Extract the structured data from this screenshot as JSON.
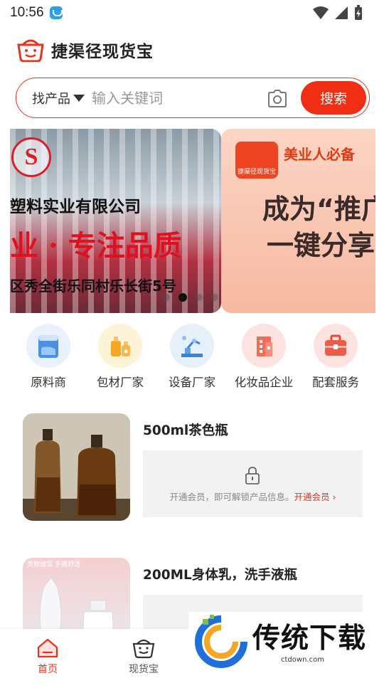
{
  "status_bar": {
    "time": "10:56"
  },
  "header": {
    "title": "捷渠径现货宝"
  },
  "search": {
    "category": "找产品",
    "placeholder": "输入关键词",
    "button_label": "搜索"
  },
  "banner": {
    "slide1": {
      "line1": "塑料实业有限公司",
      "line2": "业 · 专注品质",
      "line3": "区秀全街乐同村乐长街5号"
    },
    "slide2": {
      "logo_text": "捷渠径现货宝",
      "tag": "美业人必备",
      "headline1": "成为“推广",
      "headline2": "一键分享"
    },
    "active_dot": 1
  },
  "categories": [
    {
      "label": "原料商",
      "icon": "raw-material-icon",
      "bg": "#e8f1fd"
    },
    {
      "label": "包材厂家",
      "icon": "packaging-icon",
      "bg": "#fdf3d7"
    },
    {
      "label": "设备厂家",
      "icon": "equipment-icon",
      "bg": "#e5f0fb"
    },
    {
      "label": "化妆品企业",
      "icon": "building-icon",
      "bg": "#fde3df"
    },
    {
      "label": "配套服务",
      "icon": "toolbox-icon",
      "bg": "#fde3df"
    }
  ],
  "products": [
    {
      "title": "500ml茶色瓶",
      "lock_text": "开通会员，即可解锁产品信息。",
      "lock_link": "开通会员 ›"
    },
    {
      "title": "200ML身体乳，洗手液瓶",
      "image_caption": "亮丽诚驾 手感舒适"
    }
  ],
  "bottom_nav": [
    {
      "label": "首页",
      "icon": "home-icon",
      "active": true
    },
    {
      "label": "现货宝",
      "icon": "basket-icon",
      "active": false
    }
  ],
  "watermark": {
    "text": "传统下载",
    "sub": "ctdown.com"
  },
  "colors": {
    "accent": "#ef2e14",
    "text": "#222222",
    "muted": "#888888"
  }
}
